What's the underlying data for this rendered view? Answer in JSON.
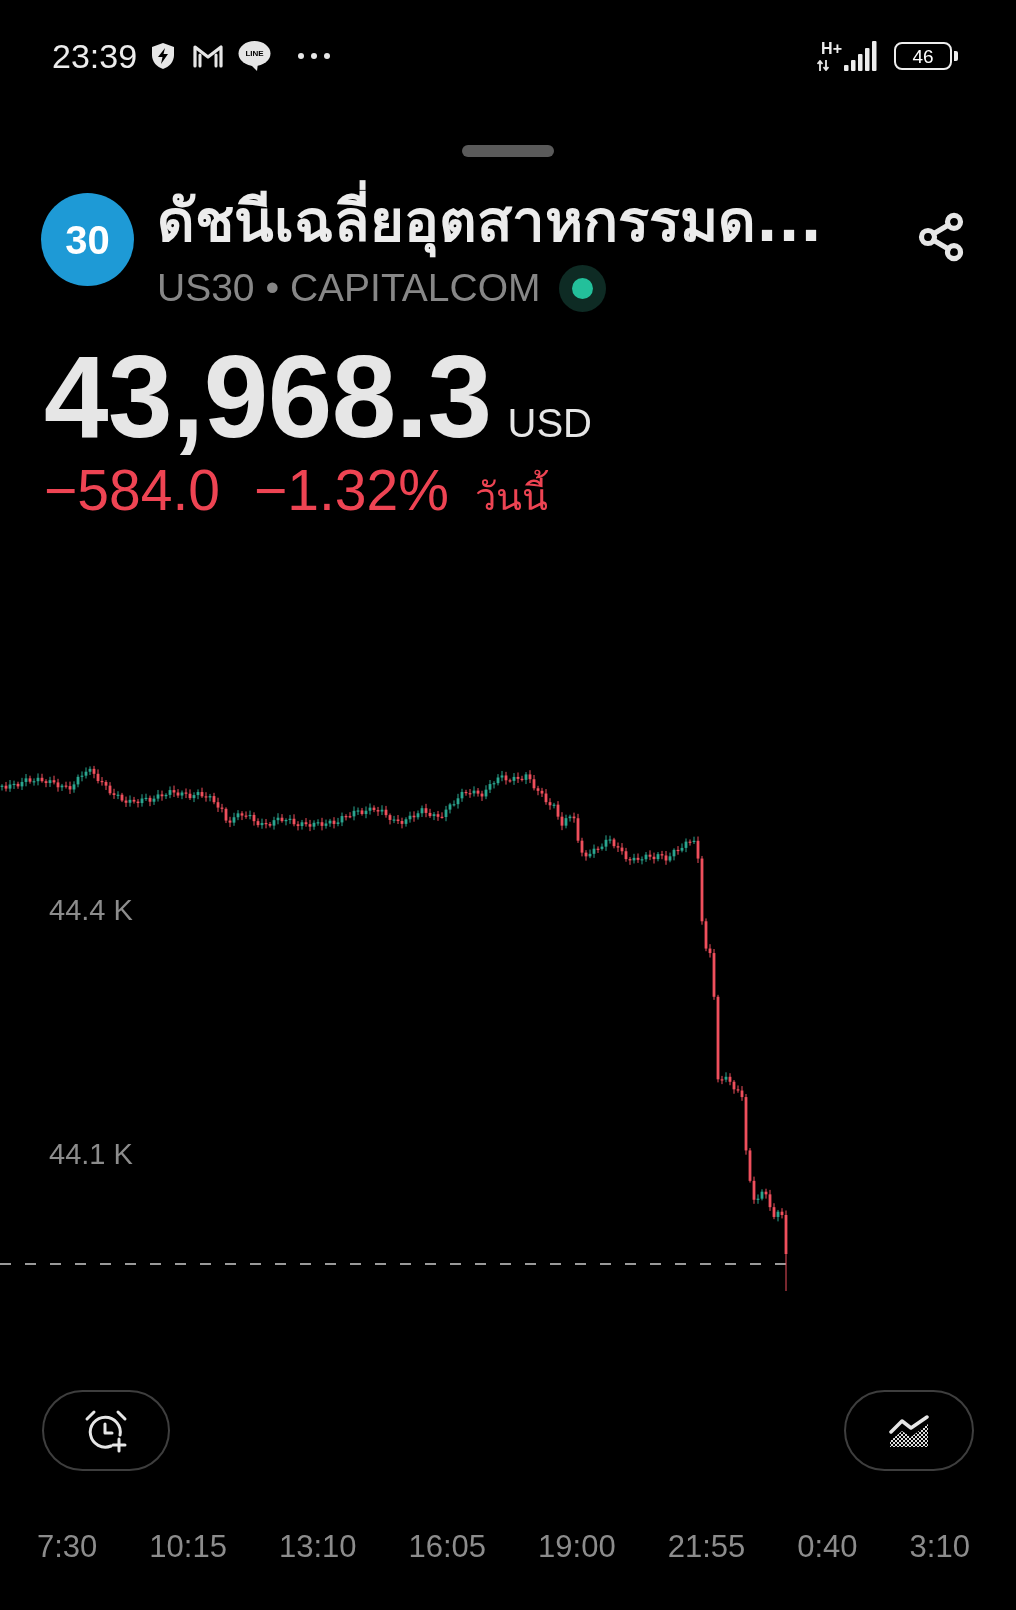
{
  "status_bar": {
    "time": "23:39",
    "chat_badge": "LINE",
    "network_type": "H+",
    "battery": "46"
  },
  "header": {
    "symbol_badge": "30",
    "title": "ดัชนีเฉลี่ยอุตสาหกรรมด...",
    "subtitle": "US30 • CAPITALCOM",
    "market_open": true
  },
  "quote": {
    "price": "43,968.3",
    "currency": "USD",
    "change": "−584.0",
    "change_percent": "−1.32%",
    "period": "วันนี้",
    "negative": true
  },
  "chart": {
    "y_labels": [
      "44.4 K",
      "44.1 K"
    ]
  },
  "time_axis": [
    "7:30",
    "10:15",
    "13:10",
    "16:05",
    "19:00",
    "21:55",
    "0:40",
    "3:10"
  ]
}
